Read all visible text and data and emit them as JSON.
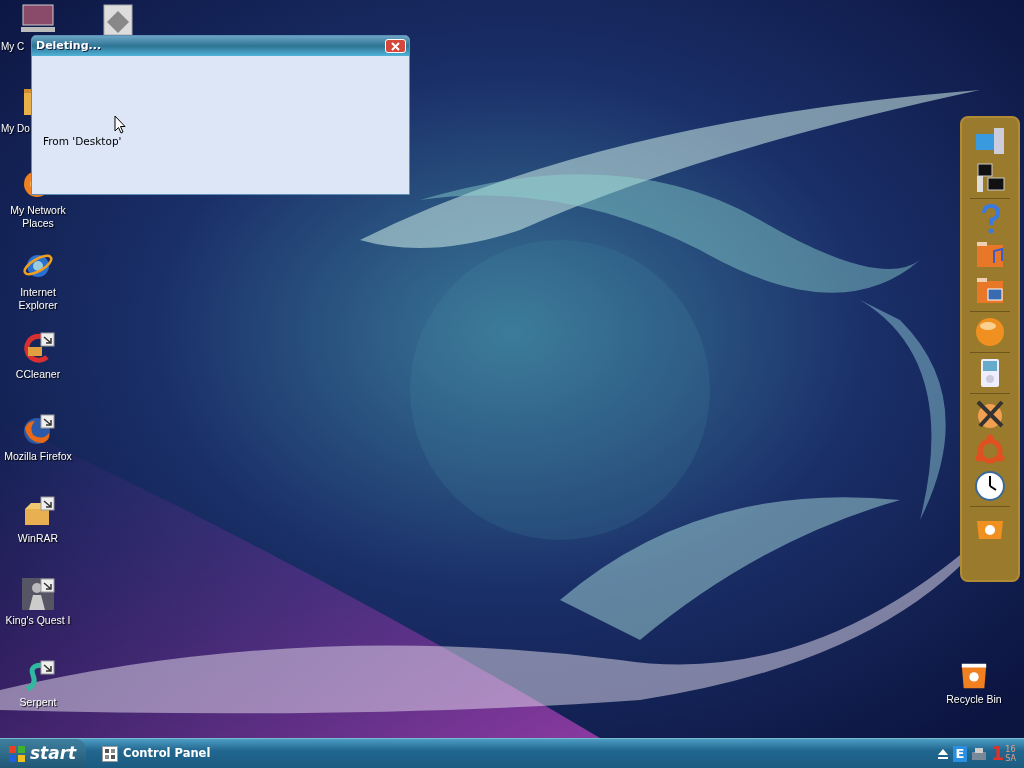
{
  "window": {
    "title": "Deleting...",
    "message": "From 'Desktop'"
  },
  "desktop_icons": [
    {
      "label": "My C"
    },
    {
      "label": "My Do"
    },
    {
      "label": "My Network Places"
    },
    {
      "label": "Internet Explorer"
    },
    {
      "label": "CCleaner"
    },
    {
      "label": "Mozilla Firefox"
    },
    {
      "label": "WinRAR"
    },
    {
      "label": "King's Quest I"
    },
    {
      "label": "Serpent"
    }
  ],
  "recycle_bin": {
    "label": "Recycle Bin"
  },
  "taskbar": {
    "start": "start",
    "tasks": [
      {
        "label": "Control Panel",
        "selected": false
      }
    ],
    "tray_letter": "E",
    "clock": {
      "hour": "1",
      "minutes": "16",
      "period": "SA"
    }
  }
}
